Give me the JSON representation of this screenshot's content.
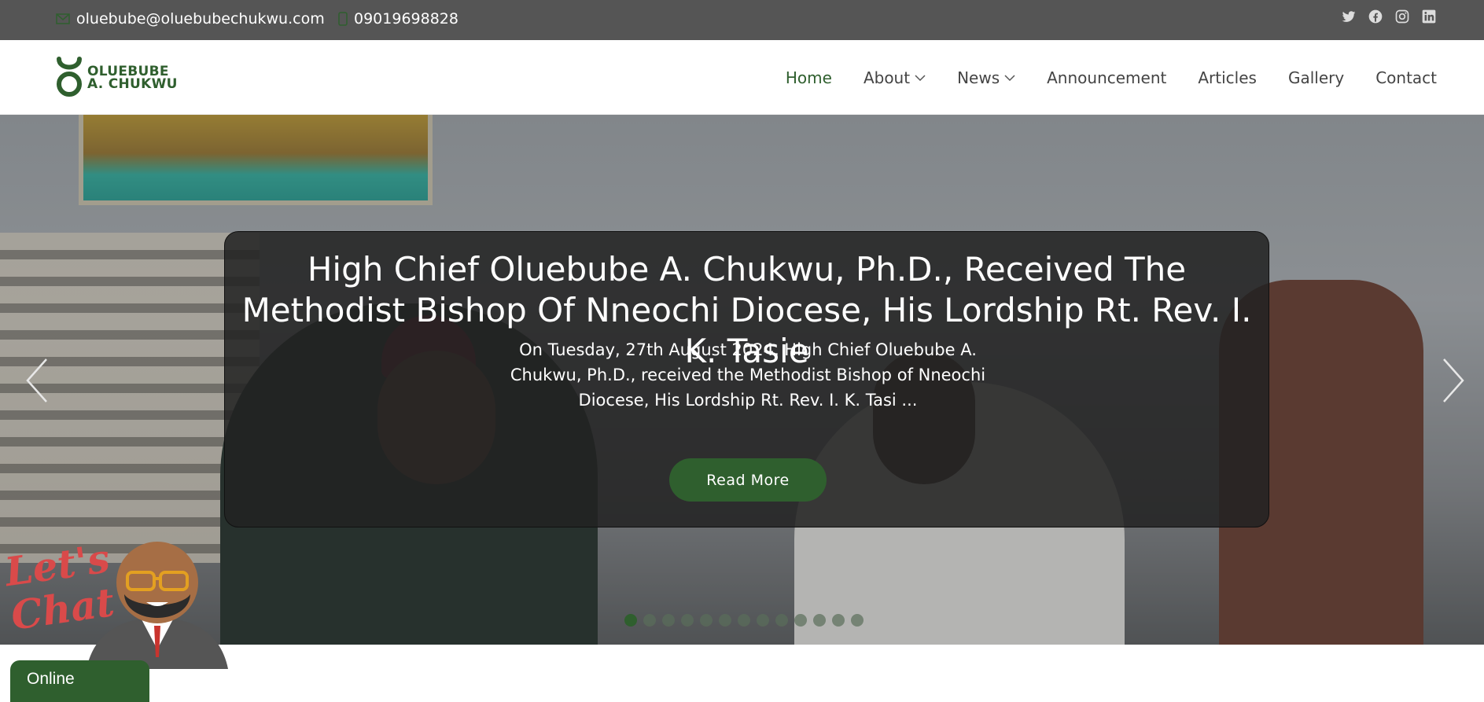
{
  "topbar": {
    "email": "oluebube@oluebubechukwu.com",
    "phone": "09019698828",
    "socials": [
      "twitter-icon",
      "facebook-icon",
      "instagram-icon",
      "linkedin-icon"
    ]
  },
  "header": {
    "logo_line1": "OLUEBUBE",
    "logo_line2": "A. CHUKWU",
    "nav": [
      {
        "label": "Home",
        "active": true
      },
      {
        "label": "About",
        "dropdown": true
      },
      {
        "label": "News",
        "dropdown": true
      },
      {
        "label": "Announcement"
      },
      {
        "label": "Articles"
      },
      {
        "label": "Gallery"
      },
      {
        "label": "Contact"
      }
    ]
  },
  "hero": {
    "title": "High Chief Oluebube A. Chukwu, Ph.D., Received The Methodist Bishop Of Nneochi Diocese, His Lordship Rt. Rev. I. K. Tasie",
    "excerpt": "On Tuesday, 27th August 2024, High Chief Oluebube A. Chukwu, Ph.D., received the Methodist Bishop of Nneochi Diocese, His Lordship Rt. Rev. I. K. Tasi ...",
    "button_label": "Read More",
    "slide_count": 13,
    "active_slide": 1
  },
  "chat": {
    "lets": "Let's",
    "chat": "Chat",
    "status": "Online"
  },
  "colors": {
    "brand_green": "#2f5f2e",
    "topbar_bg": "#555555",
    "card_bg": "#222222",
    "chat_red": "#d94a4a"
  }
}
